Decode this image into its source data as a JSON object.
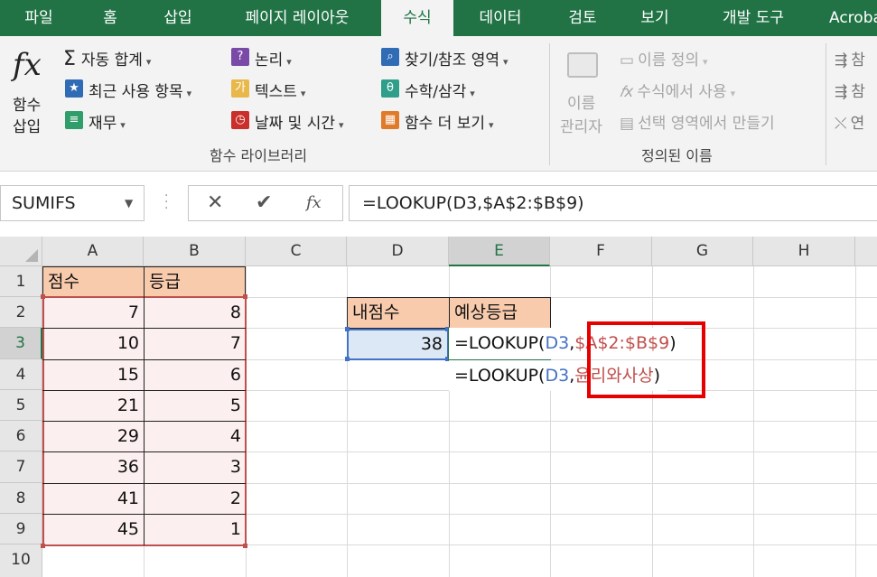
{
  "tabs": [
    {
      "label": "파일",
      "active": false
    },
    {
      "label": "홈",
      "active": false
    },
    {
      "label": "삽입",
      "active": false
    },
    {
      "label": "페이지 레이아웃",
      "active": false
    },
    {
      "label": "수식",
      "active": true
    },
    {
      "label": "데이터",
      "active": false
    },
    {
      "label": "검토",
      "active": false
    },
    {
      "label": "보기",
      "active": false
    },
    {
      "label": "개발 도구",
      "active": false
    },
    {
      "label": "Acroba",
      "active": false
    }
  ],
  "ribbon": {
    "insert_function": {
      "line1": "함수",
      "line2": "삽입",
      "icon": "fx-icon"
    },
    "library_col1": [
      "자동 합계",
      "최근 사용 항목",
      "재무"
    ],
    "library_col2": [
      "논리",
      "텍스트",
      "날짜 및 시간"
    ],
    "library_col3": [
      "찾기/참조 영역",
      "수학/삼각",
      "함수 더 보기"
    ],
    "library_group_label": "함수 라이브러리",
    "name_manager": {
      "line1": "이름",
      "line2": "관리자"
    },
    "defined_names": [
      "이름 정의",
      "수식에서 사용",
      "선택 영역에서 만들기"
    ],
    "defined_group_label": "정의된 이름",
    "audit_partial": [
      "참",
      "참",
      "연"
    ]
  },
  "formula_bar": {
    "name_box": "SUMIFS",
    "cancel_glyph": "✕",
    "enter_glyph": "✔",
    "fx_glyph": "fx",
    "formula": "=LOOKUP(D3,$A$2:$B$9)"
  },
  "columns": [
    "A",
    "B",
    "C",
    "D",
    "E",
    "F",
    "G",
    "H"
  ],
  "rows": [
    "1",
    "2",
    "3",
    "4",
    "5",
    "6",
    "7",
    "8",
    "9",
    "10"
  ],
  "table": {
    "headers": [
      "점수",
      "등급"
    ],
    "rows": [
      [
        "7",
        "8"
      ],
      [
        "10",
        "7"
      ],
      [
        "15",
        "6"
      ],
      [
        "21",
        "5"
      ],
      [
        "29",
        "4"
      ],
      [
        "36",
        "3"
      ],
      [
        "41",
        "2"
      ],
      [
        "45",
        "1"
      ]
    ]
  },
  "my_score": {
    "label": "내점수",
    "value": "38"
  },
  "expected_grade": {
    "label": "예상등급"
  },
  "formula_line1": {
    "prefix": "=LOOKUP(",
    "ref": "D3",
    "comma": ",",
    "range": "$A$2:$B$9",
    "close": ")"
  },
  "formula_line2": {
    "prefix": "=LOOKUP(",
    "ref": "D3",
    "comma": ",",
    "range": "윤리와사상",
    "close": ")"
  },
  "colors": {
    "excel_green": "#217346",
    "header_fill": "#f8cbad",
    "range_red": "#c0504d",
    "ref_blue": "#4472c4",
    "callout_red": "#e60000"
  }
}
